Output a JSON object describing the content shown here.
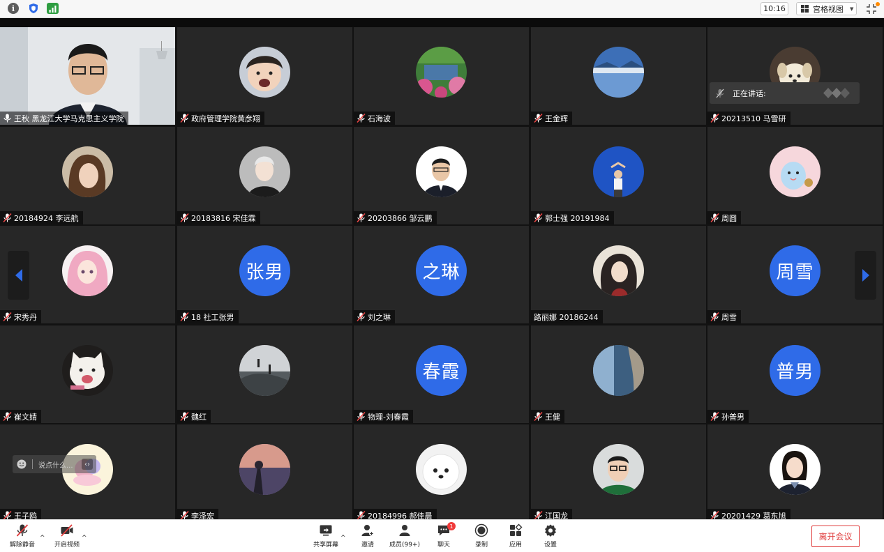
{
  "top_bar": {
    "time": "10:16",
    "view_label": "宫格视图"
  },
  "speaking": {
    "label": "正在讲话:"
  },
  "chat": {
    "placeholder": "说点什么..."
  },
  "tiles": [
    {
      "name": "王秋   黑龙江大学马克思主义学院",
      "type": "video",
      "mic": "on"
    },
    {
      "name": "政府管理学院黄彦翔",
      "type": "photo",
      "mic": "muted",
      "avatar": "child-photo"
    },
    {
      "name": "石海波",
      "type": "photo",
      "mic": "muted",
      "avatar": "garden-photo"
    },
    {
      "name": "王金辉",
      "type": "photo",
      "mic": "muted",
      "avatar": "lake-photo"
    },
    {
      "name": "20213510 马雪研",
      "type": "photo",
      "mic": "muted",
      "avatar": "puppy-photo"
    },
    {
      "name": "20184924 李远航",
      "type": "photo",
      "mic": "muted",
      "avatar": "woman-photo"
    },
    {
      "name": "20183816 宋佳霖",
      "type": "photo",
      "mic": "muted",
      "avatar": "man-portrait"
    },
    {
      "name": "20203866 邹云鹏",
      "type": "photo",
      "mic": "muted",
      "avatar": "man-suit-photo"
    },
    {
      "name": "郭士强 20191984",
      "type": "photo",
      "mic": "muted",
      "avatar": "blue-sky-photo"
    },
    {
      "name": "周圆",
      "type": "photo",
      "mic": "muted",
      "avatar": "cartoon-bird"
    },
    {
      "name": "宋秀丹",
      "type": "photo",
      "mic": "muted",
      "avatar": "anime-girl"
    },
    {
      "name": "18 社工张男",
      "type": "text",
      "mic": "muted",
      "initials": "张男"
    },
    {
      "name": "刘之琳",
      "type": "text",
      "mic": "muted",
      "initials": "之琳"
    },
    {
      "name": "路丽娜 20186244",
      "type": "photo",
      "mic": "none",
      "avatar": "illustrated-woman"
    },
    {
      "name": "周雪",
      "type": "text",
      "mic": "muted",
      "initials": "周雪"
    },
    {
      "name": "崔文婧",
      "type": "photo",
      "mic": "muted",
      "avatar": "cat-photo"
    },
    {
      "name": "魏红",
      "type": "photo",
      "mic": "muted",
      "avatar": "rocks-photo"
    },
    {
      "name": "物理-刘春霞",
      "type": "text",
      "mic": "muted",
      "initials": "春霞"
    },
    {
      "name": "王健",
      "type": "photo",
      "mic": "muted",
      "avatar": "seaside-photo"
    },
    {
      "name": "孙普男",
      "type": "text",
      "mic": "muted",
      "initials": "普男"
    },
    {
      "name": "王子鸥",
      "type": "photo",
      "mic": "muted",
      "avatar": "pastel-art"
    },
    {
      "name": "李泽宏",
      "type": "photo",
      "mic": "muted",
      "avatar": "sunset-photo"
    },
    {
      "name": "20184996 郝佳晨",
      "type": "photo",
      "mic": "muted",
      "avatar": "white-dog-photo"
    },
    {
      "name": "江国龙",
      "type": "photo",
      "mic": "muted",
      "avatar": "boy-glasses-photo"
    },
    {
      "name": "20201429 葛东旭",
      "type": "photo",
      "mic": "muted",
      "avatar": "girl-uniform-photo"
    }
  ],
  "toolbar": {
    "unmute": "解除静音",
    "start_video": "开启视频",
    "share_screen": "共享屏幕",
    "invite": "邀请",
    "members": "成员(99+)",
    "chat": "聊天",
    "chat_badge": "1",
    "record": "录制",
    "apps": "应用",
    "settings": "设置",
    "leave": "离开会议"
  },
  "colors": {
    "accent_blue": "#2f6be8",
    "leave_red": "#e03c3c",
    "tile_bg": "#272727"
  }
}
